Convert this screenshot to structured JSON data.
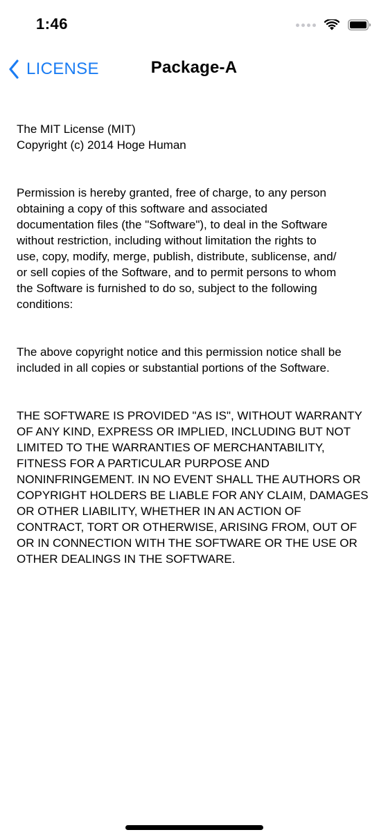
{
  "status_bar": {
    "time": "1:46",
    "icons": [
      "signal-dots-icon",
      "wifi-icon",
      "battery-icon"
    ]
  },
  "nav": {
    "back_label": "LICENSE",
    "title": "Package-A"
  },
  "license": {
    "header": "The MIT License (MIT)\nCopyright (c) 2014 Hoge Human",
    "permission": "Permission is hereby granted, free of charge, to any person\nobtaining a copy of this software and associated\ndocumentation files (the \"Software\"), to deal in the Software\nwithout restriction, including without limitation the rights to\nuse, copy, modify, merge, publish, distribute, sublicense, and/\nor sell copies of the Software, and to permit persons to whom\nthe Software is furnished to do so, subject to the following\nconditions:",
    "notice": "The above copyright notice and this permission notice shall be\nincluded in all copies or substantial portions of the Software.",
    "warranty": "THE SOFTWARE IS PROVIDED \"AS IS\", WITHOUT WARRANTY\nOF ANY KIND, EXPRESS OR IMPLIED, INCLUDING BUT NOT\nLIMITED TO THE WARRANTIES OF MERCHANTABILITY,\nFITNESS FOR A PARTICULAR PURPOSE AND\nNONINFRINGEMENT. IN NO EVENT SHALL THE AUTHORS OR\nCOPYRIGHT HOLDERS BE LIABLE FOR ANY CLAIM, DAMAGES\nOR OTHER LIABILITY, WHETHER IN AN ACTION OF\nCONTRACT, TORT OR OTHERWISE, ARISING FROM, OUT OF\nOR IN CONNECTION WITH THE SOFTWARE OR THE USE OR\nOTHER DEALINGS IN THE SOFTWARE."
  },
  "colors": {
    "accent": "#1a7cf3",
    "text": "#000000",
    "background": "#ffffff"
  }
}
